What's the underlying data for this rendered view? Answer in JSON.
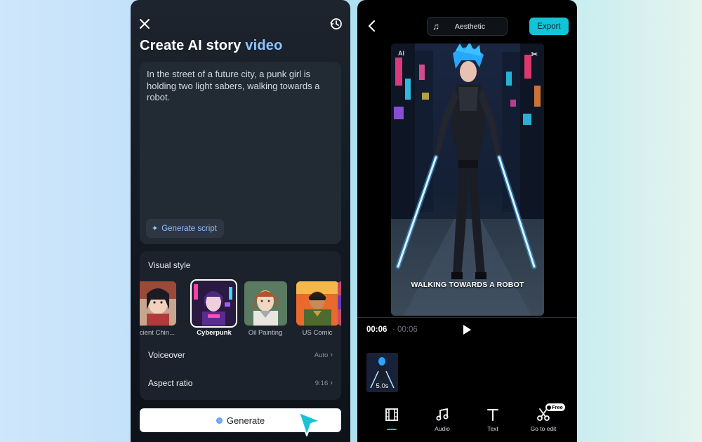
{
  "left_screen": {
    "title_main": "Create AI story ",
    "title_accent": "video",
    "prompt_text": "In the street of a future city, a punk girl is holding two light sabers, walking towards a robot.",
    "generate_script_label": "Generate script",
    "visual_style_label": "Visual style",
    "styles": [
      {
        "label": "cient Chin...",
        "selected": false
      },
      {
        "label": "Cyberpunk",
        "selected": true
      },
      {
        "label": "Oil Painting",
        "selected": false
      },
      {
        "label": "US Comic",
        "selected": false
      }
    ],
    "voiceover_label": "Voiceover",
    "voiceover_value": "Auto",
    "aspect_label": "Aspect ratio",
    "aspect_value": "9:16",
    "generate_label": "Generate",
    "icons": [
      "close-icon",
      "history-icon",
      "sparkle-icon",
      "cursor-icon"
    ]
  },
  "right_screen": {
    "music_name": "Aesthetic",
    "export_label": "Export",
    "watermark_ai": "AI",
    "caption": "WALKING TOWARDS A ROBOT",
    "time_current": "00:06",
    "time_total": "· 00:06",
    "clip_duration": "5.0s",
    "toolbar": {
      "video_label": "",
      "audio_label": "Audio",
      "text_label": "Text",
      "edit_label": "Go to edit",
      "free_badge": "Free"
    },
    "colors": {
      "accent": "#13c4d8"
    },
    "icons": [
      "back-icon",
      "music-note-icon",
      "play-icon",
      "film-icon",
      "audio-icon",
      "text-icon",
      "scissors-icon"
    ]
  }
}
